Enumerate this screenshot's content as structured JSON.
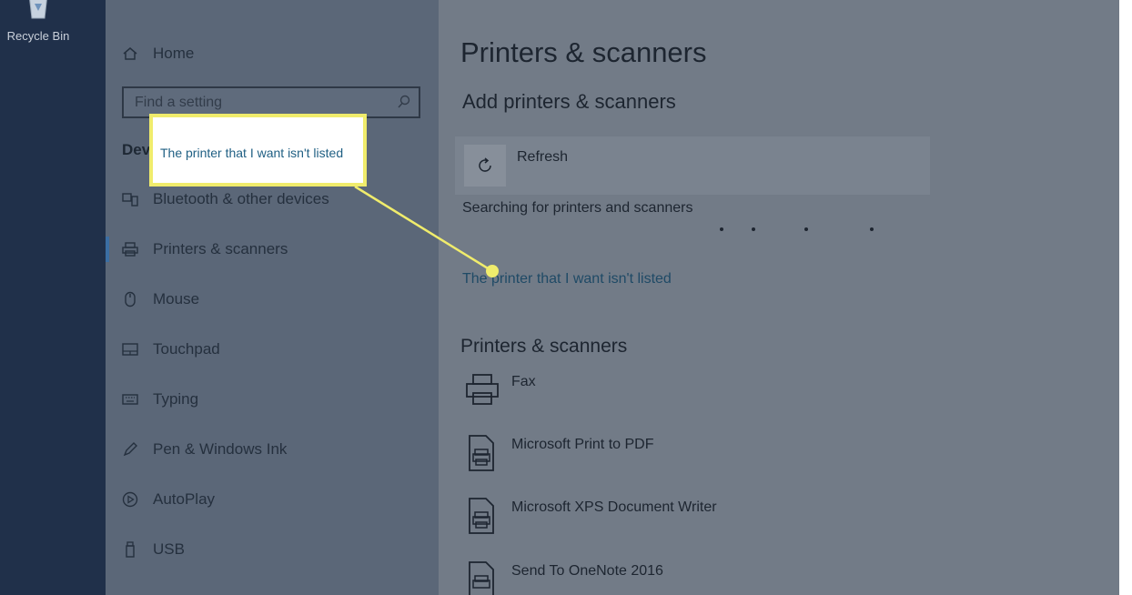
{
  "desktop": {
    "recycle_bin_label": "Recycle Bin"
  },
  "sidebar": {
    "home_label": "Home",
    "search_placeholder": "Find a setting",
    "section_label": "Dev",
    "items": [
      {
        "label": "Bluetooth & other devices",
        "icon": "bluetooth-devices-icon"
      },
      {
        "label": "Printers & scanners",
        "icon": "printer-icon",
        "active": true
      },
      {
        "label": "Mouse",
        "icon": "mouse-icon"
      },
      {
        "label": "Touchpad",
        "icon": "touchpad-icon"
      },
      {
        "label": "Typing",
        "icon": "keyboard-icon"
      },
      {
        "label": "Pen & Windows Ink",
        "icon": "pen-icon"
      },
      {
        "label": "AutoPlay",
        "icon": "autoplay-icon"
      },
      {
        "label": "USB",
        "icon": "usb-icon"
      }
    ]
  },
  "content": {
    "title": "Printers & scanners",
    "add_heading": "Add printers & scanners",
    "refresh_label": "Refresh",
    "searching_text": "Searching for printers and scanners",
    "not_listed_link": "The printer that I want isn't listed",
    "list_heading": "Printers & scanners",
    "devices": [
      {
        "name": "Fax",
        "icon": "fax-icon"
      },
      {
        "name": "Microsoft Print to PDF",
        "icon": "document-printer-icon"
      },
      {
        "name": "Microsoft XPS Document Writer",
        "icon": "document-printer-icon"
      },
      {
        "name": "Send To OneNote 2016",
        "icon": "document-printer-icon"
      }
    ]
  },
  "callout": {
    "text": "The printer that I want isn't listed",
    "border_color": "#f0ec6c",
    "pointer_color": "#f0ec6c"
  }
}
